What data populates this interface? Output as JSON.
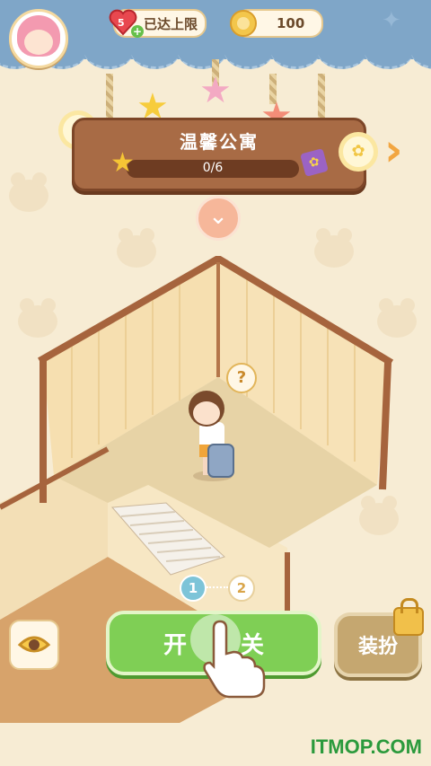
{
  "status": {
    "lives_count": "5",
    "lives_text": "已达上限",
    "coins": "100"
  },
  "level": {
    "title": "温馨公寓",
    "progress_text": "0/6",
    "progress_fraction": 0
  },
  "steps": {
    "current": "1",
    "next": "2"
  },
  "buttons": {
    "start": "开关",
    "dress_up": "装扮"
  },
  "watermark": "ITMOP.COM",
  "colors": {
    "topbar": "#7fa6c8",
    "start_button": "#7fcf55",
    "dress_button": "#c5a770",
    "sign": "#a86b45"
  },
  "icons": [
    "avatar",
    "heart-icon",
    "coin-icon",
    "star-icon",
    "candy-icon",
    "chevron-right-icon",
    "chevron-down-icon",
    "question-icon",
    "eye-icon",
    "lock-icon",
    "pointer-hand-icon"
  ]
}
